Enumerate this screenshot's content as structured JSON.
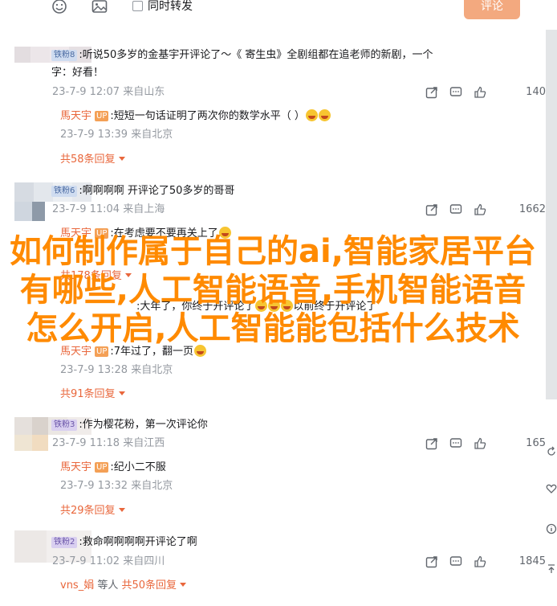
{
  "toolbar": {
    "emoji_icon": "smile-icon",
    "image_icon": "image-icon",
    "sync_label": "同时转发",
    "submit_label": "评论"
  },
  "comments": [
    {
      "badge": "铁粉8",
      "badge_kind": "fan",
      "text_line1": ":听说50多岁的金基宇开评论了～《 寄生虫》全剧组都在追",
      "text_line1b": "老师的新剧，一个",
      "text_line2": "字：好看！",
      "date": "23-7-9 12:07",
      "location": "来自山东",
      "likes": "140",
      "reply": {
        "name": "馬天宇",
        "text": ":短短一句话证明了两次你的数学水平（    ）",
        "date": "23-7-9 13:39",
        "location": "来自北京"
      },
      "more": "共58条回复"
    },
    {
      "badge": "铁粉6",
      "badge_kind": "fan",
      "text_line1": ":啊啊啊啊 开评论了50多岁的哥哥",
      "date": "23-7-9 11:04",
      "location": "来自上海",
      "likes": "1662",
      "reply": {
        "name": "馬天宇",
        "text": ":在考虑要不要再关上了",
        "date": "",
        "location": ""
      },
      "more": "共178条回复"
    },
    {
      "badge": "",
      "badge_kind": "fan",
      "text_line1": ":大年了，你终于开评论了",
      "text_line1b": "以前终于开评论了",
      "date": "",
      "location": "",
      "likes": "",
      "reply": {
        "name": "馬天宇",
        "text": ":7年过了，翻一页",
        "date": "23-7-9 13:28",
        "location": "来自北京"
      },
      "more": "共91条回复"
    },
    {
      "badge": "铁粉3",
      "badge_kind": "lv",
      "text_line1": ":作为樱花粉，第一次评论你",
      "date": "23-7-9 11:18",
      "location": "来自江西",
      "likes": "165",
      "reply": {
        "name": "馬天宇",
        "text": ":纪小二不服",
        "date": "23-7-9 13:32",
        "location": "来自北京"
      },
      "more": "共29条回复"
    },
    {
      "badge": "铁粉2",
      "badge_kind": "lv",
      "text_line1": ":救命啊啊啊啊开评论了啊",
      "date": "23-7-9 11:02",
      "location": "来自四川",
      "likes": "1845",
      "reply_inline": {
        "name": "vns_娟",
        "text": "等人",
        "more": "共50条回复"
      }
    }
  ],
  "side_tools": [
    "refresh-icon",
    "heart-icon",
    "info-icon",
    "top-icon"
  ],
  "overlay_title": "如何制作属于自己的ai,智能家居平台有哪些,人工智能语音,手机智能语音怎么开启,人工智能能包括什么技术",
  "colors": {
    "accent": "#e9673c",
    "overlay": "#ff8a00",
    "submit_bg": "#f3a97f",
    "meta_gray": "#9499a0"
  }
}
